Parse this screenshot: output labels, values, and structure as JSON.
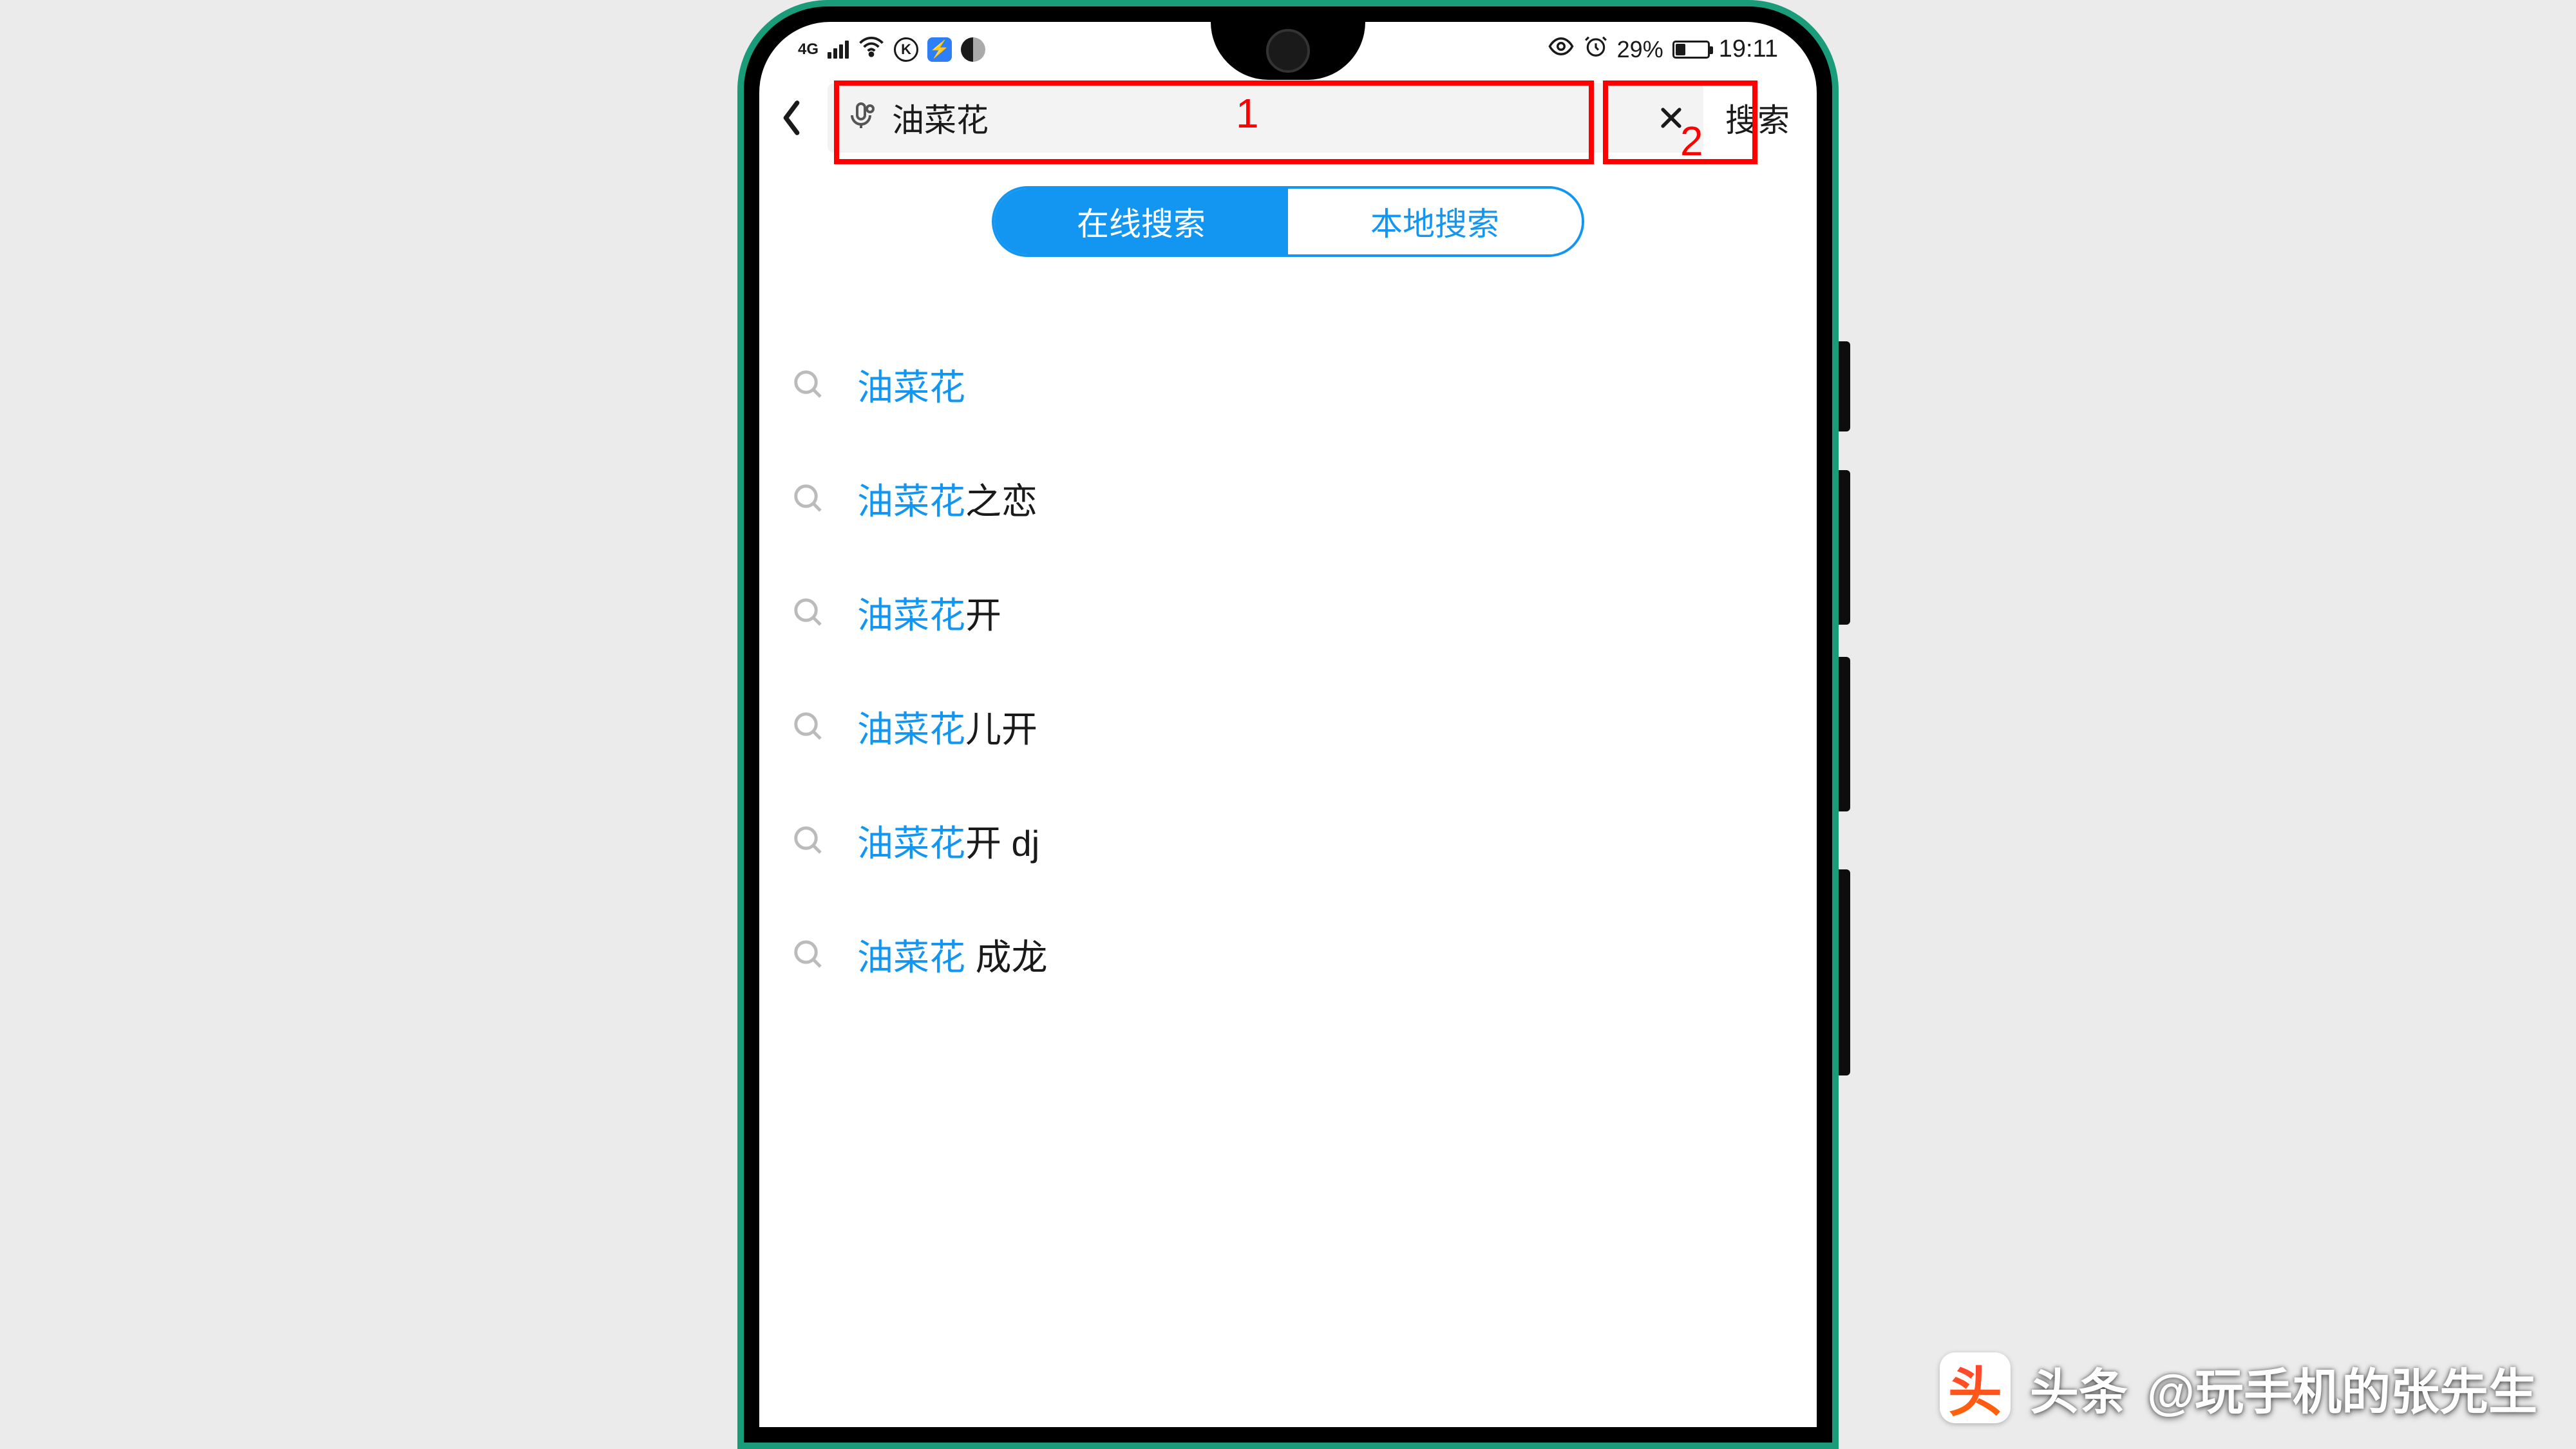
{
  "status": {
    "network_tag": "4G",
    "battery_percent": "29%",
    "time": "19:11"
  },
  "search": {
    "value": "油菜花",
    "button_label": "搜索"
  },
  "annotations": {
    "label1": "1",
    "label2": "2"
  },
  "segments": {
    "online": "在线搜索",
    "local": "本地搜索"
  },
  "suggestions": [
    {
      "highlight": "油菜花",
      "rest": ""
    },
    {
      "highlight": "油菜花",
      "rest": "之恋"
    },
    {
      "highlight": "油菜花",
      "rest": "开"
    },
    {
      "highlight": "油菜花",
      "rest": "儿开"
    },
    {
      "highlight": "油菜花",
      "rest": "开 dj"
    },
    {
      "highlight": "油菜花",
      "rest": " 成龙"
    }
  ],
  "watermark": {
    "logo_text": "头",
    "brand": "头条",
    "handle": "@玩手机的张先生"
  },
  "colors": {
    "accent_blue": "#1396f2",
    "annotation_red": "#f00",
    "frame_green": "#1a9b7a"
  }
}
